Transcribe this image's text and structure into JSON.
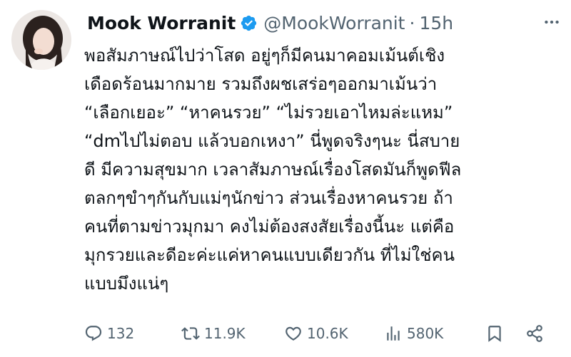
{
  "author": {
    "display_name": "Mook Worranit",
    "handle": "@MookWorranit",
    "separator": "·",
    "time": "15h",
    "verified": true,
    "avatar_icon": "avatar-photo"
  },
  "more_icon": "more-dots-icon",
  "tweet": {
    "lines": [
      "พอสัมภาษณ์ไปว่าโสด อยู่ๆก็มีคนมาคอมเม้นต์เชิง",
      "เดือดร้อนมากมาย รวมถึงผชเสร่อๆออกมาเม้นว่า",
      "“เลือกเยอะ” “หาคนรวย”  “ไม่รวยเอาไหมล่ะแหม”",
      "“dmไปไม่ตอบ แล้วบอกเหงา” นี่พูดจริงๆนะ นี่สบาย",
      "ดี มีความสุขมาก เวลาสัมภาษณ์เรื่องโสดมันก็พูดฟีล",
      "ตลกๆขำๆกันกับแม่ๆนักข่าว ส่วนเรื่องหาคนรวย ถ้า",
      "คนที่ตามข่าวมุกมา คงไม่ต้องสงสัยเรื่องนี้นะ แต่คือ",
      "มุกรวยและดีอะค่ะแค่หาคนแบบเดียวกัน ที่ไม่ใช่คน",
      "แบบมึงแน่ๆ"
    ]
  },
  "actions": {
    "reply": {
      "icon": "reply-icon",
      "count": "132"
    },
    "retweet": {
      "icon": "retweet-icon",
      "count": "11.9K"
    },
    "like": {
      "icon": "heart-icon",
      "count": "10.6K"
    },
    "views": {
      "icon": "views-bar-chart-icon",
      "count": "580K"
    },
    "bookmark": {
      "icon": "bookmark-icon"
    },
    "share": {
      "icon": "share-icon"
    }
  },
  "colors": {
    "text": "#0f1419",
    "secondary": "#536471",
    "verified": "#1d9bf0"
  }
}
